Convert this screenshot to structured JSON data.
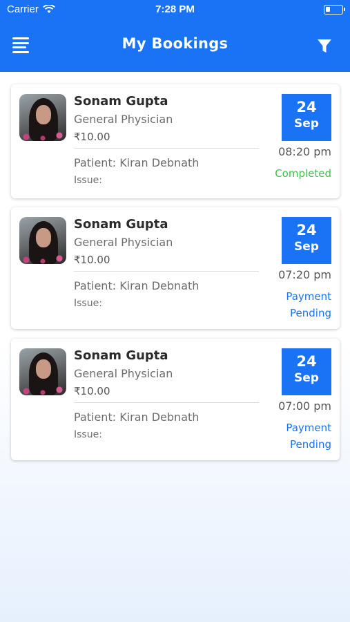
{
  "status_bar": {
    "carrier": "Carrier",
    "time": "7:28 PM",
    "battery_level": 0.3
  },
  "header": {
    "title": "My Bookings",
    "menu_icon": "menu-icon",
    "filter_icon": "filter-icon",
    "accent_color": "#1a73f5"
  },
  "bookings": [
    {
      "doctor_name": "Sonam Gupta",
      "specialty": "General Physician",
      "fee": "₹10.00",
      "patient": "Patient: Kiran Debnath",
      "issue": "Issue:",
      "day": "24",
      "month": "Sep",
      "time": "08:20 pm",
      "status_line1": "Completed",
      "status_line2": "",
      "status_color": "#3fbf4a"
    },
    {
      "doctor_name": "Sonam Gupta",
      "specialty": "General Physician",
      "fee": "₹10.00",
      "patient": "Patient: Kiran Debnath",
      "issue": "Issue:",
      "day": "24",
      "month": "Sep",
      "time": "07:20 pm",
      "status_line1": "Payment",
      "status_line2": "Pending",
      "status_color": "#1a73f5"
    },
    {
      "doctor_name": "Sonam Gupta",
      "specialty": "General Physician",
      "fee": "₹10.00",
      "patient": "Patient: Kiran Debnath",
      "issue": "Issue:",
      "day": "24",
      "month": "Sep",
      "time": "07:00 pm",
      "status_line1": "Payment",
      "status_line2": "Pending",
      "status_color": "#1a73f5"
    }
  ]
}
